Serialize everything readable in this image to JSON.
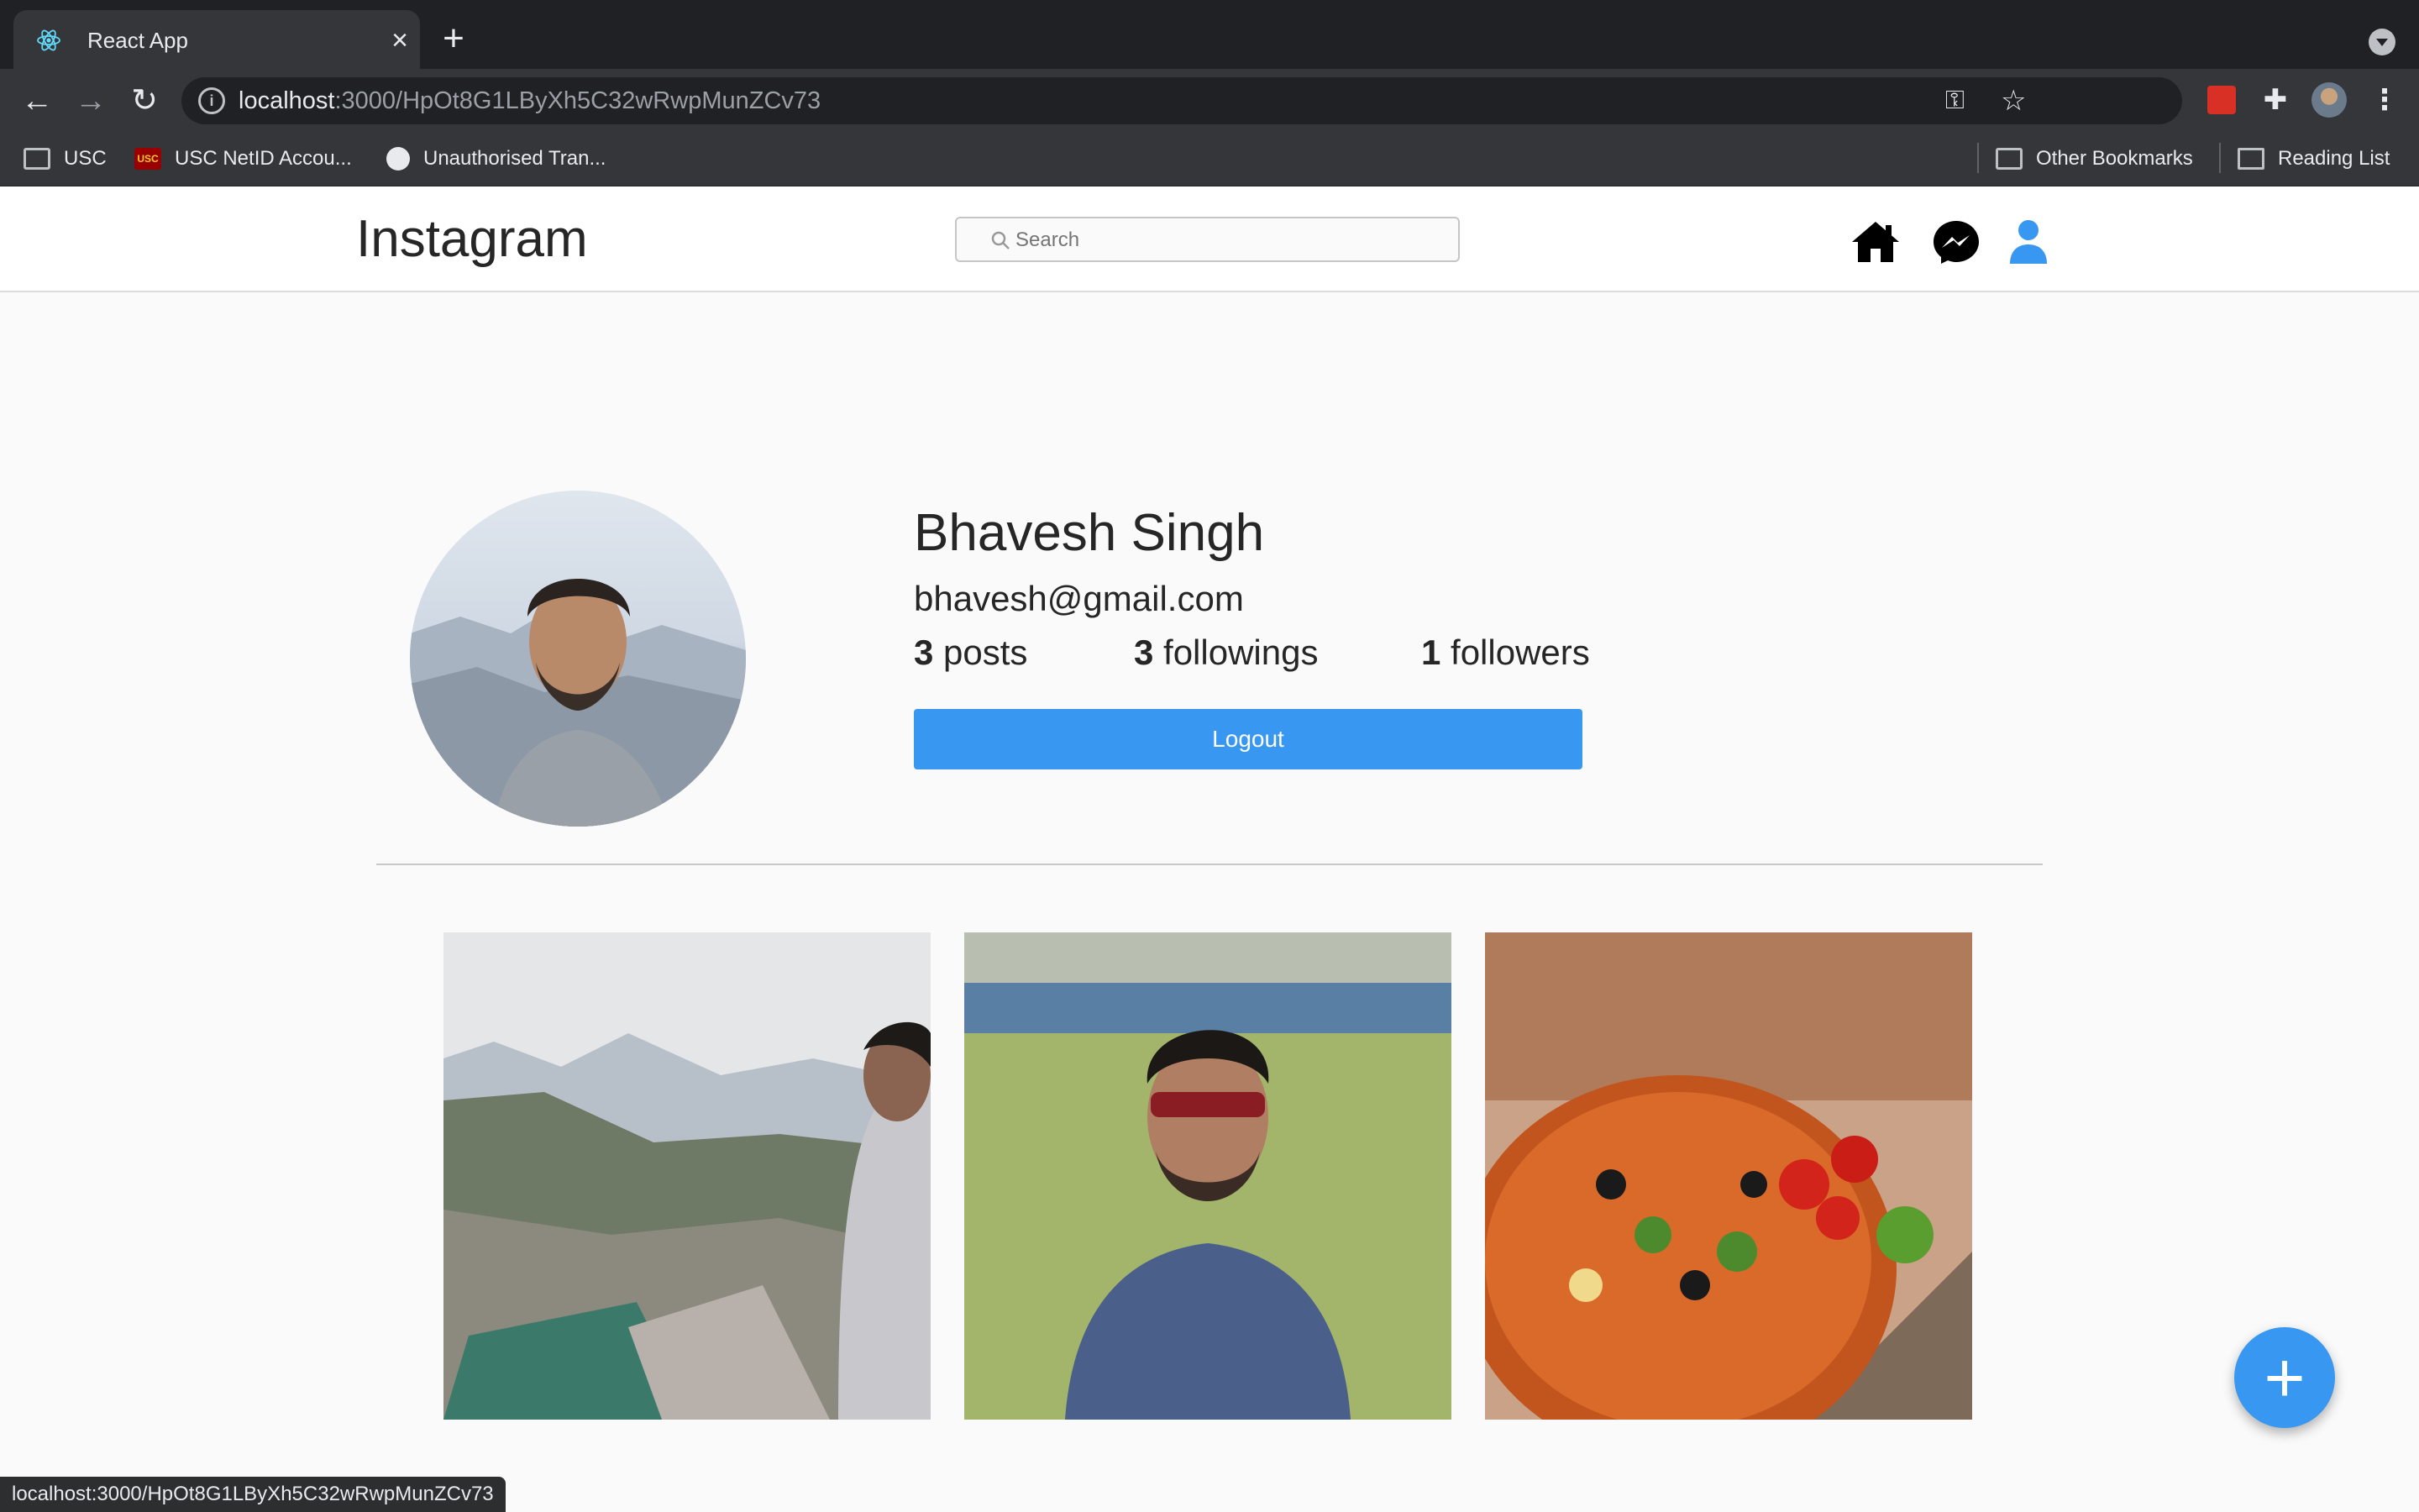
{
  "browser": {
    "tab_title": "React App",
    "url_host": "localhost",
    "url_rest": ":3000/HpOt8G1LByXh5C32wRwpMunZCv73",
    "bookmarks": [
      {
        "label": "USC"
      },
      {
        "label": "USC NetID Accou..."
      },
      {
        "label": "Unauthorised Tran..."
      }
    ],
    "other_bookmarks": "Other Bookmarks",
    "reading_list": "Reading List",
    "status_url": "localhost:3000/HpOt8G1LByXh5C32wRwpMunZCv73"
  },
  "app": {
    "brand": "Instagram",
    "search_placeholder": "Search",
    "accent_color": "#3897f0"
  },
  "profile": {
    "name": "Bhavesh Singh",
    "email": "bhavesh@gmail.com",
    "posts_count": "3",
    "posts_label": "posts",
    "followings_count": "3",
    "followings_label": "followings",
    "followers_count": "1",
    "followers_label": "followers",
    "logout_label": "Logout"
  },
  "fab_label": "+"
}
